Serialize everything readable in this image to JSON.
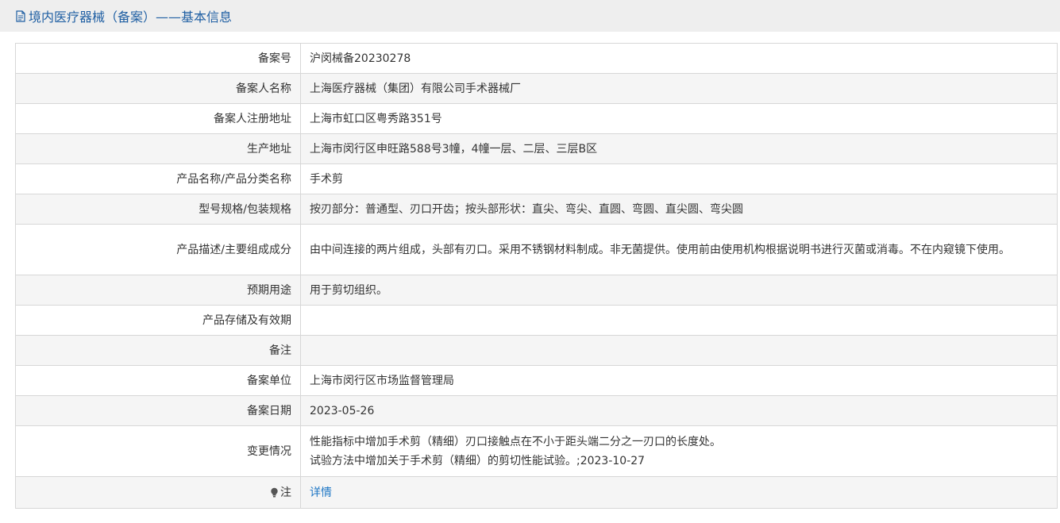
{
  "header": {
    "title": "境内医疗器械（备案）——基本信息",
    "icon": "document-icon"
  },
  "rows": [
    {
      "label": "备案号",
      "value": "沪闵械备20230278"
    },
    {
      "label": "备案人名称",
      "value": "上海医疗器械（集团）有限公司手术器械厂"
    },
    {
      "label": "备案人注册地址",
      "value": "上海市虹口区粤秀路351号"
    },
    {
      "label": "生产地址",
      "value": "上海市闵行区申旺路588号3幢，4幢一层、二层、三层B区"
    },
    {
      "label": "产品名称/产品分类名称",
      "value": "手术剪"
    },
    {
      "label": "型号规格/包装规格",
      "value": "按刃部分：普通型、刃口开齿；按头部形状：直尖、弯尖、直圆、弯圆、直尖圆、弯尖圆"
    },
    {
      "label": "产品描述/主要组成成分",
      "value": "由中间连接的两片组成，头部有刃口。采用不锈钢材料制成。非无菌提供。使用前由使用机构根据说明书进行灭菌或消毒。不在内窥镜下使用。"
    },
    {
      "label": "预期用途",
      "value": "用于剪切组织。"
    },
    {
      "label": "产品存储及有效期",
      "value": ""
    },
    {
      "label": "备注",
      "value": ""
    },
    {
      "label": "备案单位",
      "value": "上海市闵行区市场监督管理局"
    },
    {
      "label": "备案日期",
      "value": "2023-05-26"
    }
  ],
  "change": {
    "label": "变更情况",
    "line1": "性能指标中增加手术剪（精细）刃口接触点在不小于距头端二分之一刃口的长度处。",
    "line2": "试验方法中增加关于手术剪（精细）的剪切性能试验。;2023-10-27"
  },
  "note": {
    "label": "注",
    "icon": "lightbulb-icon",
    "link_text": "详情"
  },
  "colors": {
    "header_text": "#1f5fa3",
    "link": "#1f77c5",
    "stripe": "#f5f5f5",
    "border": "#d7d7d7"
  }
}
